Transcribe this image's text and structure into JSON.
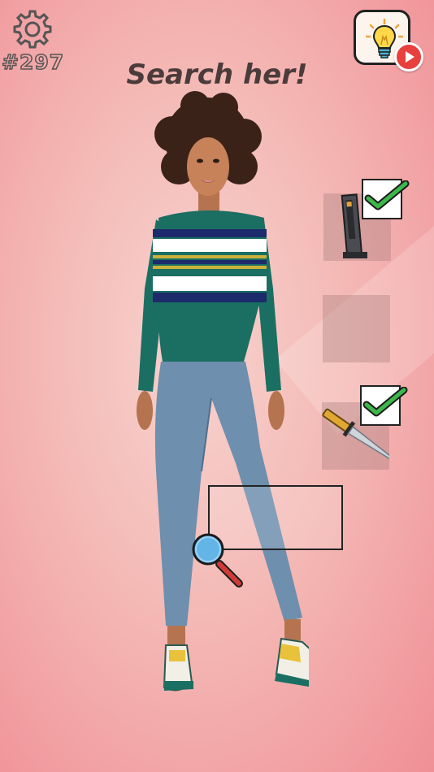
{
  "level": {
    "label": "#297"
  },
  "title": "Search her!",
  "icons": {
    "settings": "gear-icon",
    "hint": "lightbulb-icon",
    "video": "play-icon",
    "found": "checkmark-icon",
    "search": "magnifier-icon"
  },
  "items": [
    {
      "name": "ammo-magazine",
      "found": true
    },
    {
      "name": "unknown",
      "found": false
    },
    {
      "name": "knife",
      "found": true
    }
  ],
  "colors": {
    "accent_check": "#3cb84a",
    "video_badge": "#e8403d",
    "title": "#4b3b3b"
  }
}
